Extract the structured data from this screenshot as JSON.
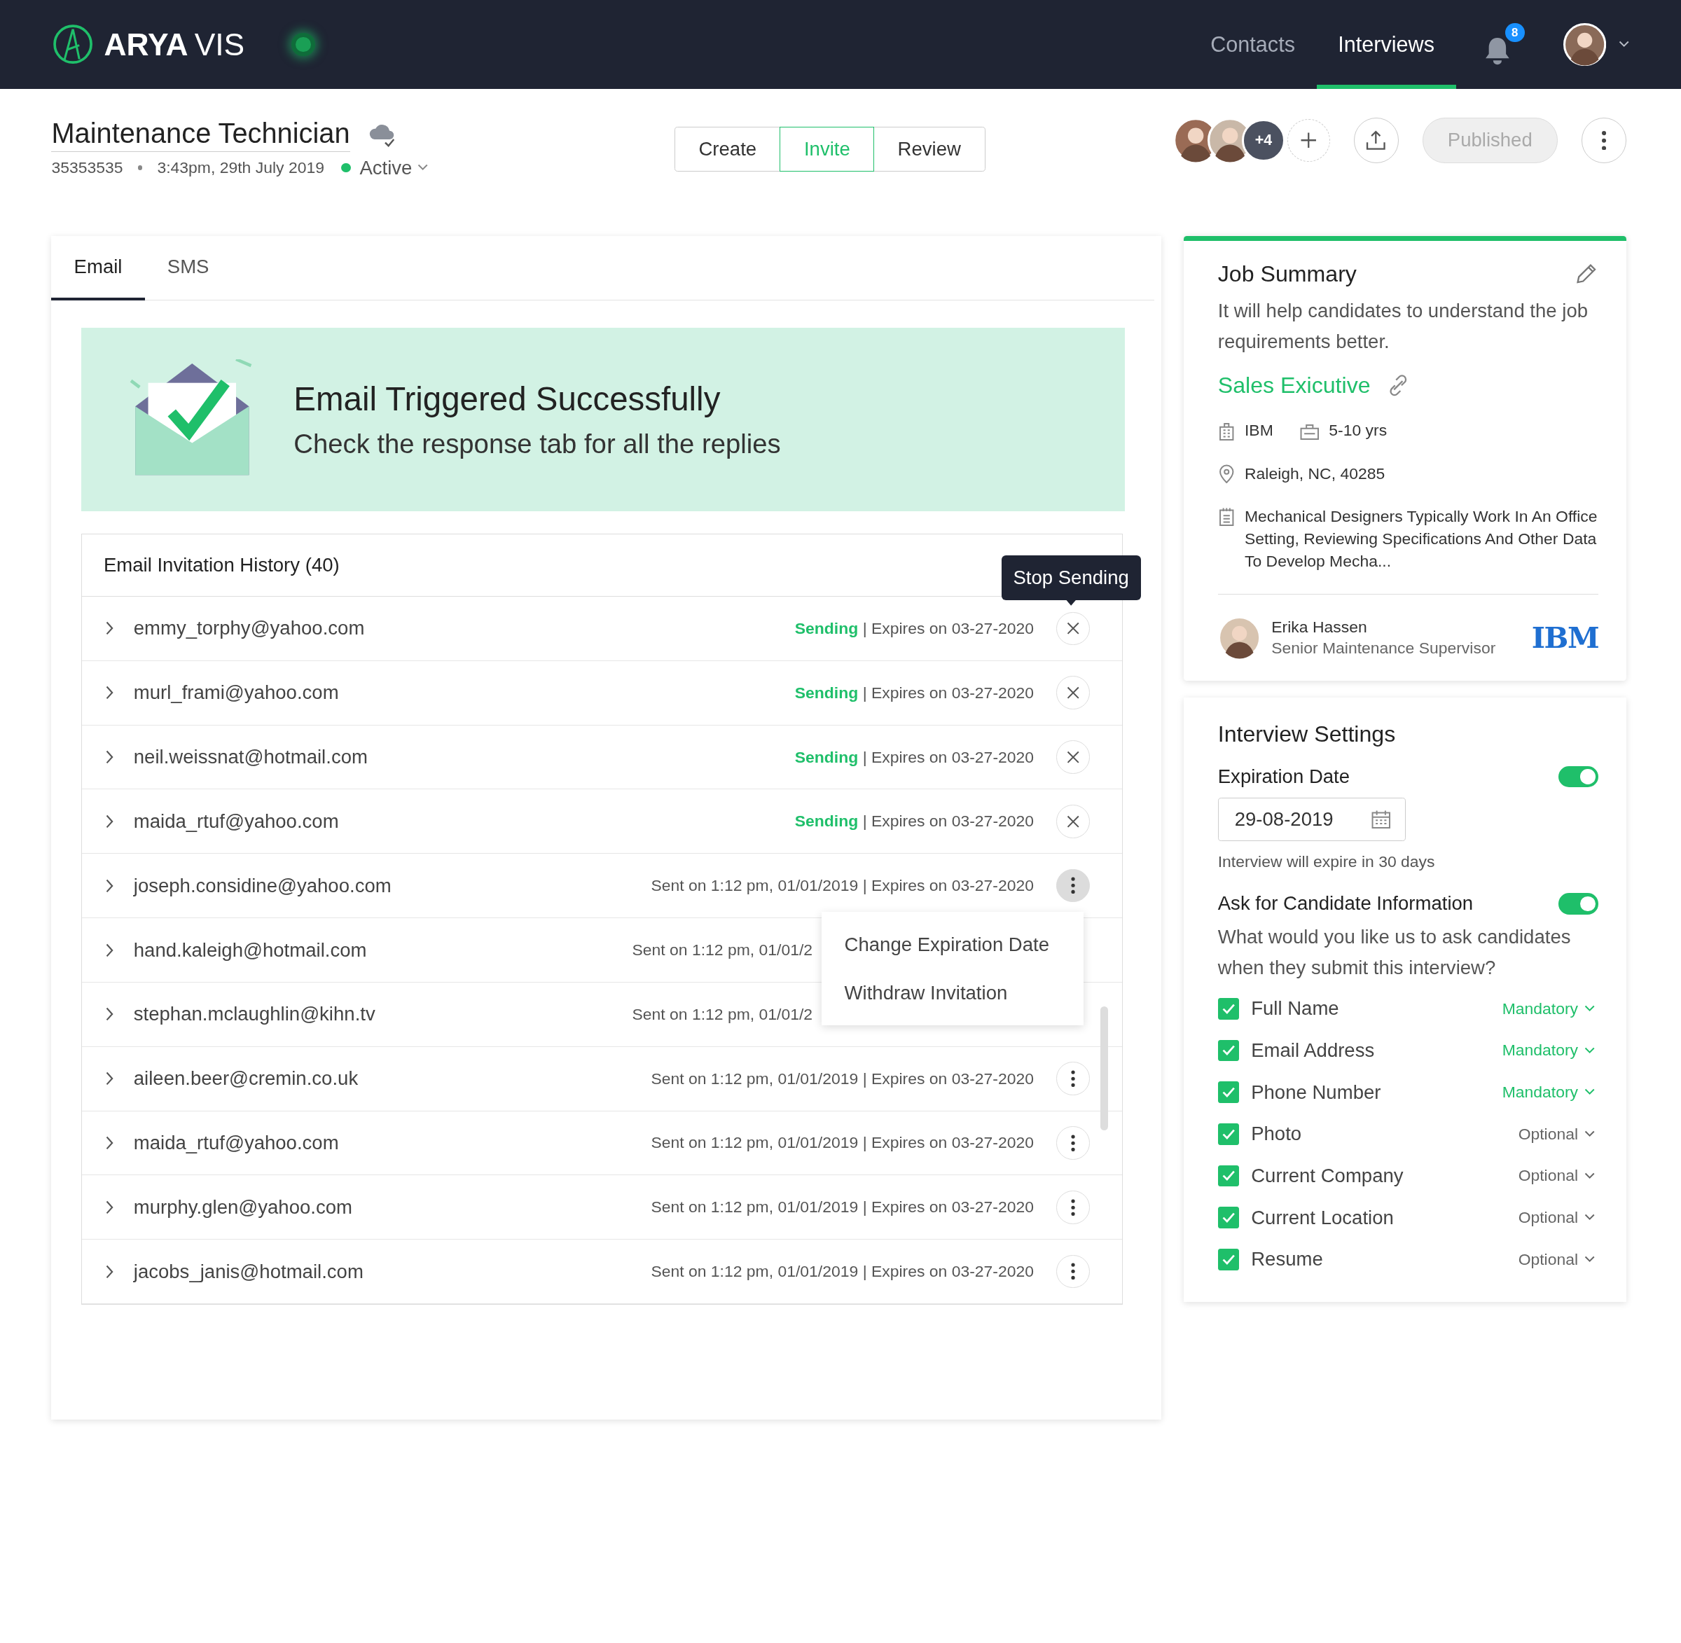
{
  "header": {
    "brand": "ARYA",
    "product": "VIS",
    "nav": [
      {
        "label": "Contacts",
        "selected": false
      },
      {
        "label": "Interviews",
        "selected": true
      }
    ],
    "notification_count": "8"
  },
  "job": {
    "title": "Maintenance Technician",
    "id": "35353535",
    "datetime": "3:43pm, 29th July 2019",
    "status": "Active"
  },
  "steps": [
    {
      "label": "Create",
      "selected": false
    },
    {
      "label": "Invite",
      "selected": true
    },
    {
      "label": "Review",
      "selected": false
    }
  ],
  "collaborators": {
    "more": "+4"
  },
  "publish_button": {
    "label": "Published",
    "disabled": true
  },
  "channel_tabs": [
    {
      "label": "Email",
      "selected": true
    },
    {
      "label": "SMS",
      "selected": false
    }
  ],
  "banner": {
    "title": "Email Triggered Successfully",
    "message": "Check the response tab for all the replies"
  },
  "history": {
    "title": "Email Invitation History (40)",
    "tooltip": "Stop Sending",
    "menu": [
      "Change Expiration Date",
      "Withdraw Invitation"
    ],
    "rows": [
      {
        "email": "emmy_torphy@yahoo.com",
        "status": "Sending",
        "meta": "| Expires on 03-27-2020",
        "kind": "stop",
        "active": false
      },
      {
        "email": "murl_frami@yahoo.com",
        "status": "Sending",
        "meta": "| Expires on 03-27-2020",
        "kind": "stop",
        "active": false
      },
      {
        "email": "neil.weissnat@hotmail.com",
        "status": "Sending",
        "meta": "| Expires on 03-27-2020",
        "kind": "stop",
        "active": false
      },
      {
        "email": "maida_rtuf@yahoo.com",
        "status": "Sending",
        "meta": "| Expires on 03-27-2020",
        "kind": "stop",
        "active": false
      },
      {
        "email": "joseph.considine@yahoo.com",
        "meta": "Sent on 1:12 pm, 01/01/2019 | Expires on 03-27-2020",
        "kind": "more",
        "active": true
      },
      {
        "email": "hand.kaleigh@hotmail.com",
        "meta": "Sent on 1:12 pm, 01/01/2"
      },
      {
        "email": "stephan.mclaughlin@kihn.tv",
        "meta": "Sent on 1:12 pm, 01/01/2"
      },
      {
        "email": "aileen.beer@cremin.co.uk",
        "meta": "Sent on 1:12 pm, 01/01/2019 | Expires on 03-27-2020",
        "kind": "more",
        "active": false
      },
      {
        "email": "maida_rtuf@yahoo.com",
        "meta": "Sent on 1:12 pm, 01/01/2019 | Expires on 03-27-2020",
        "kind": "more",
        "active": false
      },
      {
        "email": "murphy.glen@yahoo.com",
        "meta": "Sent on 1:12 pm, 01/01/2019 | Expires on 03-27-2020",
        "kind": "more",
        "active": false
      },
      {
        "email": "jacobs_janis@hotmail.com",
        "meta": "Sent on 1:12 pm, 01/01/2019 | Expires on 03-27-2020",
        "kind": "more",
        "active": false
      }
    ]
  },
  "job_summary": {
    "title": "Job Summary",
    "description": "It will help candidates to understand the job requirements better.",
    "role": "Sales Exicutive",
    "company": "IBM",
    "experience": "5-10 yrs",
    "location": "Raleigh, NC, 40285",
    "details": "Mechanical Designers Typically Work In An Office Setting, Reviewing Specifications And Other Data To Develop Mecha...",
    "recruiter": {
      "name": "Erika Hassen",
      "role": "Senior Maintenance Supervisor"
    },
    "company_logo": "IBM"
  },
  "settings": {
    "title": "Interview Settings",
    "expiration": {
      "label": "Expiration Date",
      "on": true,
      "date": "29-08-2019",
      "hint": "Interview will expire in 30 days"
    },
    "candidate_info": {
      "label": "Ask for Candidate Information",
      "on": true,
      "question": "What would you like us to ask candidates when they submit this interview?",
      "fields": [
        {
          "label": "Full Name",
          "checked": true,
          "requirement": "Mandatory"
        },
        {
          "label": "Email Address",
          "checked": true,
          "requirement": "Mandatory"
        },
        {
          "label": "Phone Number",
          "checked": true,
          "requirement": "Mandatory"
        },
        {
          "label": "Photo",
          "checked": true,
          "requirement": "Optional"
        },
        {
          "label": "Current Company",
          "checked": true,
          "requirement": "Optional"
        },
        {
          "label": "Current Location",
          "checked": true,
          "requirement": "Optional"
        },
        {
          "label": "Resume",
          "checked": true,
          "requirement": "Optional"
        }
      ]
    }
  }
}
